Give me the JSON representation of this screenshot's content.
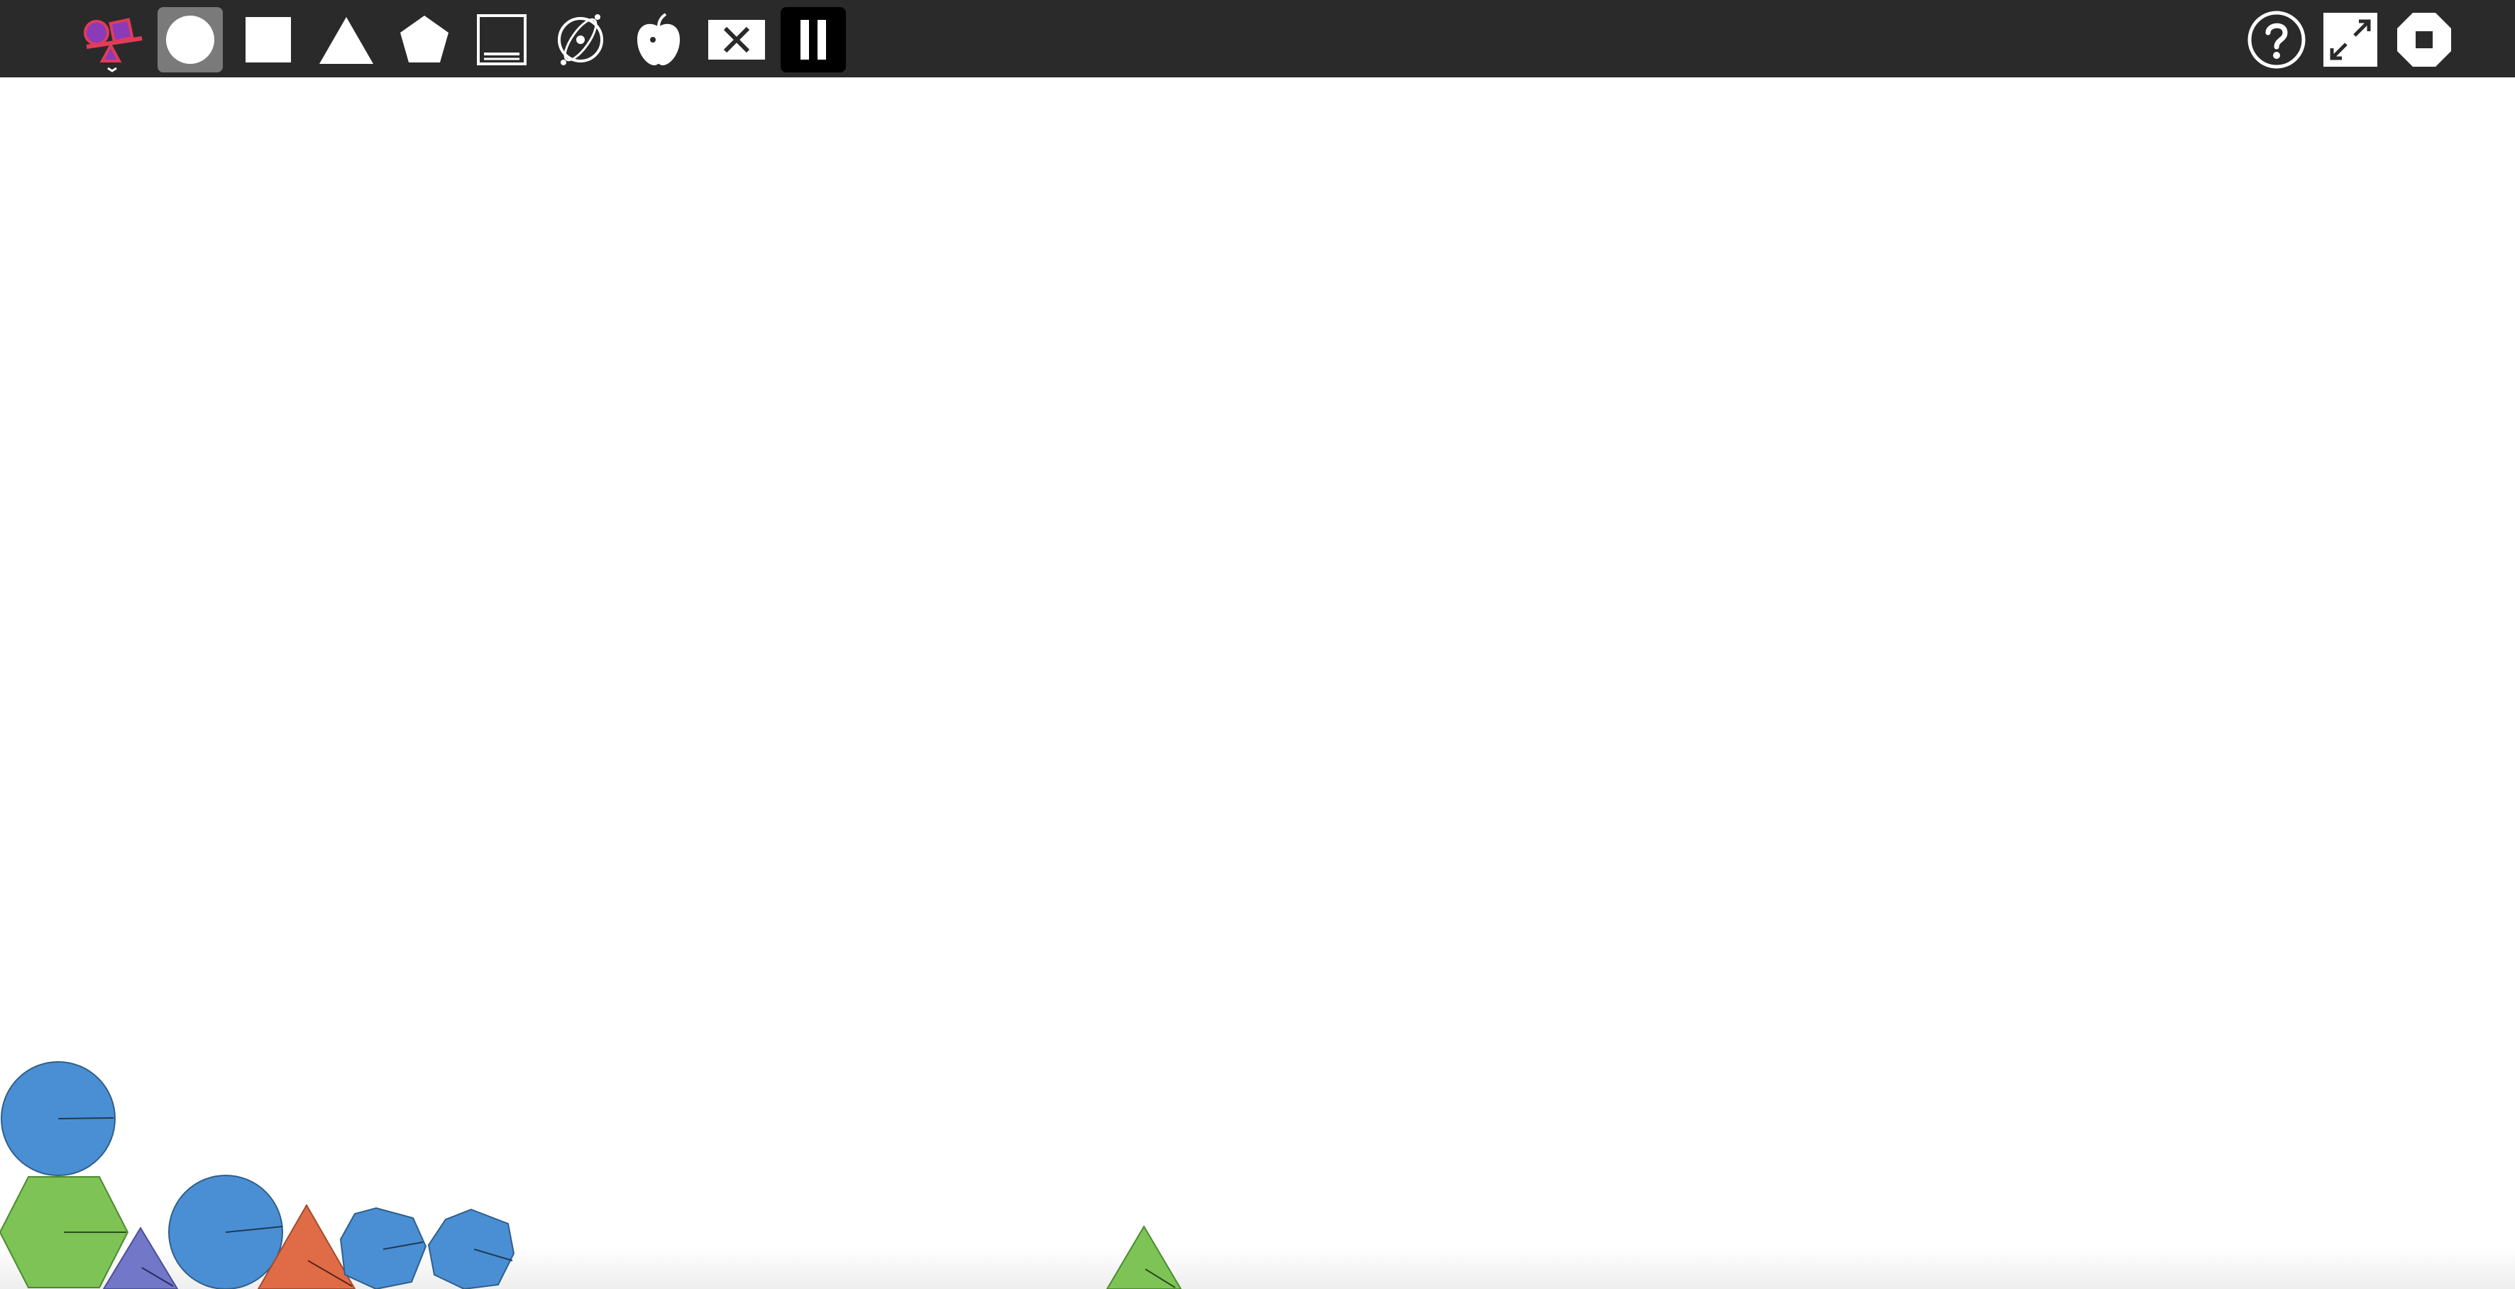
{
  "app": {
    "logo_icon": "physics-shapes-logo-icon"
  },
  "toolbar": {
    "tools": [
      {
        "name": "circle-tool",
        "icon": "circle-icon",
        "selected": true
      },
      {
        "name": "square-tool",
        "icon": "square-icon",
        "selected": false
      },
      {
        "name": "triangle-tool",
        "icon": "triangle-icon",
        "selected": false
      },
      {
        "name": "pentagon-tool",
        "icon": "pentagon-icon",
        "selected": false
      },
      {
        "name": "floor-tool",
        "icon": "floor-icon",
        "selected": false
      },
      {
        "name": "gyroscope-tool",
        "icon": "gyroscope-icon",
        "selected": false
      },
      {
        "name": "gravity-tool",
        "icon": "apple-icon",
        "selected": false
      },
      {
        "name": "clear-tool",
        "icon": "close-icon",
        "selected": false
      },
      {
        "name": "pause-tool",
        "icon": "pause-icon",
        "selected": false
      }
    ],
    "right_tools": [
      {
        "name": "help-button",
        "icon": "help-icon"
      },
      {
        "name": "fullscreen-button",
        "icon": "expand-icon"
      },
      {
        "name": "stop-button",
        "icon": "stop-icon"
      }
    ]
  },
  "colors": {
    "toolbar_bg": "#2a2a2a",
    "selected_tool_bg": "#7a7a7a",
    "blue": "#4a8fd4",
    "green": "#7ec356",
    "purple": "#7277c7",
    "orange": "#e06c47",
    "outline": "#2f5f8a",
    "logo_red": "#e03c5a",
    "logo_purple": "#8b3ab8"
  },
  "scene": {
    "shapes": [
      {
        "type": "circle",
        "color": "blue"
      },
      {
        "type": "hexagon",
        "color": "green"
      },
      {
        "type": "triangle",
        "color": "purple"
      },
      {
        "type": "circle",
        "color": "blue"
      },
      {
        "type": "triangle",
        "color": "orange"
      },
      {
        "type": "heptagon",
        "color": "blue"
      },
      {
        "type": "heptagon",
        "color": "blue"
      },
      {
        "type": "triangle",
        "color": "green"
      }
    ]
  }
}
